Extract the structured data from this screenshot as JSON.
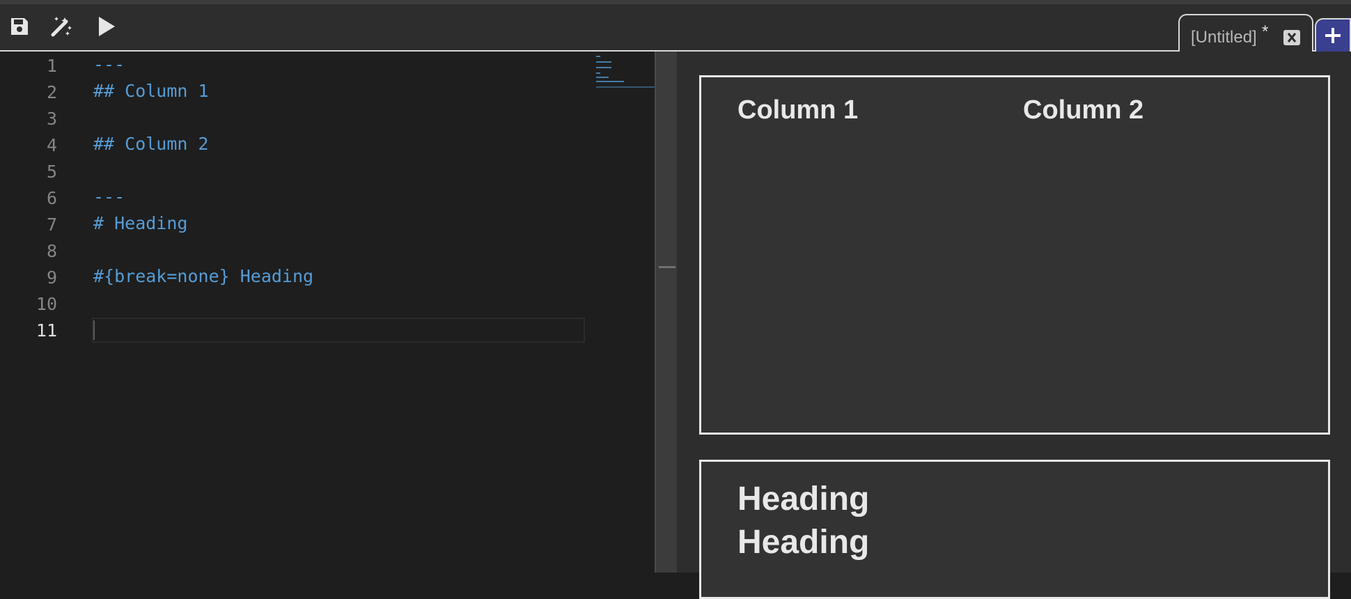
{
  "toolbar": {
    "buttons": [
      {
        "name": "save-icon"
      },
      {
        "name": "magic-wand-icon"
      },
      {
        "name": "play-icon"
      }
    ]
  },
  "tab": {
    "label": "[Untitled]",
    "modified_marker": "*",
    "close_icon": "close-box-icon"
  },
  "add_tab": {
    "icon": "plus-icon"
  },
  "editor": {
    "line_numbers": [
      "1",
      "2",
      "3",
      "4",
      "5",
      "6",
      "7",
      "8",
      "9",
      "10",
      "11"
    ],
    "active_line": "11",
    "lines": [
      "---",
      "## Column 1",
      "",
      "## Column 2",
      "",
      "---",
      "# Heading",
      "",
      "#{break=none} Heading",
      "",
      ""
    ],
    "syntax_color": "#569cd6"
  },
  "preview": {
    "slide1": {
      "column1": "Column 1",
      "column2": "Column 2"
    },
    "slide2": {
      "heading1": "Heading",
      "heading2": "Heading"
    }
  },
  "colors": {
    "accent_add_tab": "#3a3f8f",
    "slide_border": "#e8e8e8"
  }
}
